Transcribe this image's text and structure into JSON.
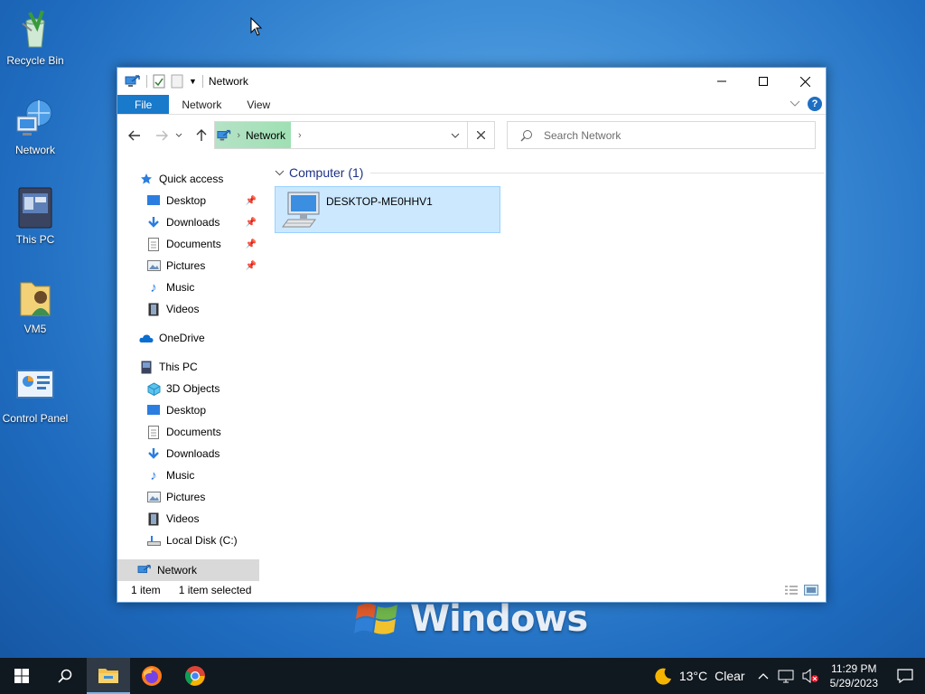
{
  "desktop": {
    "icons": [
      {
        "label": "Recycle Bin",
        "icon": "recycle-bin-icon"
      },
      {
        "label": "Network",
        "icon": "network-icon"
      },
      {
        "label": "This PC",
        "icon": "this-pc-icon"
      },
      {
        "label": "VM5",
        "icon": "user-folder-icon"
      },
      {
        "label": "Control Panel",
        "icon": "control-panel-icon"
      }
    ],
    "wallpaper_text": "Windows"
  },
  "window": {
    "title": "Network",
    "ribbon": {
      "tabs": [
        "File",
        "Network",
        "View"
      ]
    },
    "address": {
      "path": [
        "Network"
      ]
    },
    "search": {
      "placeholder": "Search Network"
    },
    "nav_pane": {
      "quick_access": "Quick access",
      "quick_items": [
        "Desktop",
        "Downloads",
        "Documents",
        "Pictures",
        "Music",
        "Videos"
      ],
      "onedrive": "OneDrive",
      "this_pc": "This PC",
      "pc_items": [
        "3D Objects",
        "Desktop",
        "Documents",
        "Downloads",
        "Music",
        "Pictures",
        "Videos",
        "Local Disk (C:)"
      ],
      "network": "Network"
    },
    "content": {
      "group_header": "Computer (1)",
      "items": [
        {
          "name": "DESKTOP-ME0HHV1",
          "selected": true
        }
      ]
    },
    "status": {
      "count": "1 item",
      "selected": "1 item selected"
    }
  },
  "taskbar": {
    "weather": {
      "temp": "13°C",
      "condition": "Clear"
    },
    "clock": {
      "time": "11:29 PM",
      "date": "5/29/2023"
    }
  },
  "colors": {
    "accent": "#1979ca",
    "selection": "#cce8ff",
    "taskbar": "#101820"
  }
}
